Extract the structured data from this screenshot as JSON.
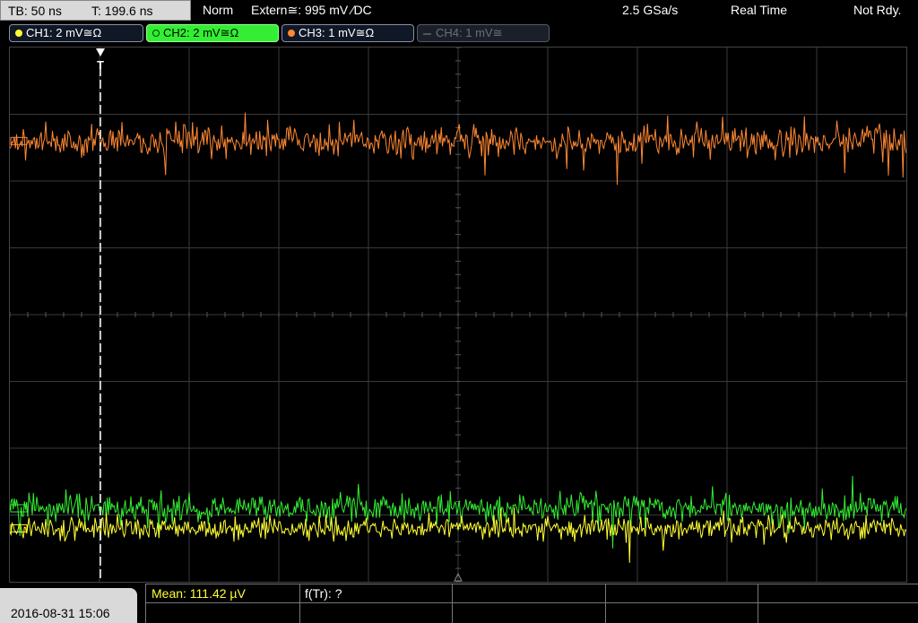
{
  "status": {
    "timebase": "TB: 50 ns",
    "trigger_time": "T: 199.6 ns",
    "trigger_mode": "Norm",
    "trigger_source": "Extern≅: 995 mV ⁄DC",
    "sample_rate": "2.5 GSa/s",
    "acq_mode": "Real Time",
    "ready_state": "Not Rdy."
  },
  "channels": [
    {
      "label": "CH1: 2 mV≅Ω",
      "color": "#ffff33",
      "active": true
    },
    {
      "label": "CH2: 2 mV≅Ω",
      "color": "#33ee33",
      "active": true,
      "selected": true
    },
    {
      "label": "CH3: 1 mV≅Ω",
      "color": "#ff8833",
      "active": true
    },
    {
      "label": "CH4: 1 mV≅",
      "color": "#666666",
      "active": false
    }
  ],
  "colors": {
    "ch1": "#ffff33",
    "ch2": "#33ee33",
    "ch3": "#ff8833",
    "grid": "#3a3a3a",
    "trigger_marker": "#ffffff"
  },
  "trigger_marker_label": "T",
  "bottom": {
    "datetime": "2016-08-31 15:06",
    "measurement_1": "Mean: 111.42 µV",
    "measurement_2": "f(Tr): ?"
  },
  "chart_data": {
    "type": "line",
    "grid": true,
    "divisions": {
      "x": 10,
      "y": 8
    },
    "series": [
      {
        "name": "CH3",
        "color": "#ff8833",
        "level_div": 2.6,
        "noise_div": 0.2
      },
      {
        "name": "CH2",
        "color": "#33ee33",
        "level_div": -2.9,
        "noise_div": 0.17
      },
      {
        "name": "CH1",
        "color": "#ffff33",
        "level_div": -3.2,
        "noise_div": 0.15
      }
    ]
  }
}
